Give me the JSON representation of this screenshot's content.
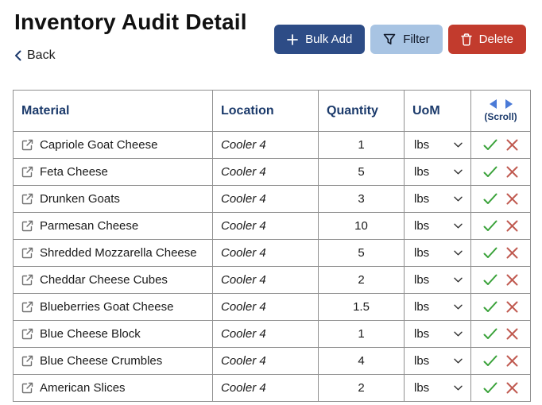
{
  "page": {
    "title": "Inventory Audit Detail",
    "back_label": "Back"
  },
  "toolbar": {
    "bulk_add_label": "Bulk Add",
    "filter_label": "Filter",
    "delete_label": "Delete"
  },
  "colors": {
    "header_text": "#1b3a6b",
    "bulk_add_bg": "#2d4c86",
    "filter_bg": "#a8c4e3",
    "delete_bg": "#c23b2d",
    "scroll_arrow": "#4a7ad7",
    "check_green": "#3aa23a",
    "x_red": "#c05a50",
    "border_gray": "#909090",
    "location_gray": "#555555"
  },
  "table": {
    "headers": {
      "material": "Material",
      "location": "Location",
      "quantity": "Quantity",
      "uom": "UoM",
      "scroll_hint": "(Scroll)"
    },
    "rows": [
      {
        "material": "Capriole Goat Cheese",
        "location": "Cooler 4",
        "quantity": "1",
        "uom": "lbs"
      },
      {
        "material": "Feta Cheese",
        "location": "Cooler 4",
        "quantity": "5",
        "uom": "lbs"
      },
      {
        "material": "Drunken Goats",
        "location": "Cooler 4",
        "quantity": "3",
        "uom": "lbs"
      },
      {
        "material": "Parmesan Cheese",
        "location": "Cooler 4",
        "quantity": "10",
        "uom": "lbs"
      },
      {
        "material": "Shredded Mozzarella Cheese",
        "location": "Cooler 4",
        "quantity": "5",
        "uom": "lbs"
      },
      {
        "material": "Cheddar Cheese Cubes",
        "location": "Cooler 4",
        "quantity": "2",
        "uom": "lbs"
      },
      {
        "material": "Blueberries Goat Cheese",
        "location": "Cooler 4",
        "quantity": "1.5",
        "uom": "lbs"
      },
      {
        "material": "Blue Cheese Block",
        "location": "Cooler 4",
        "quantity": "1",
        "uom": "lbs"
      },
      {
        "material": "Blue Cheese Crumbles",
        "location": "Cooler 4",
        "quantity": "4",
        "uom": "lbs"
      },
      {
        "material": "American Slices",
        "location": "Cooler 4",
        "quantity": "2",
        "uom": "lbs"
      }
    ]
  }
}
